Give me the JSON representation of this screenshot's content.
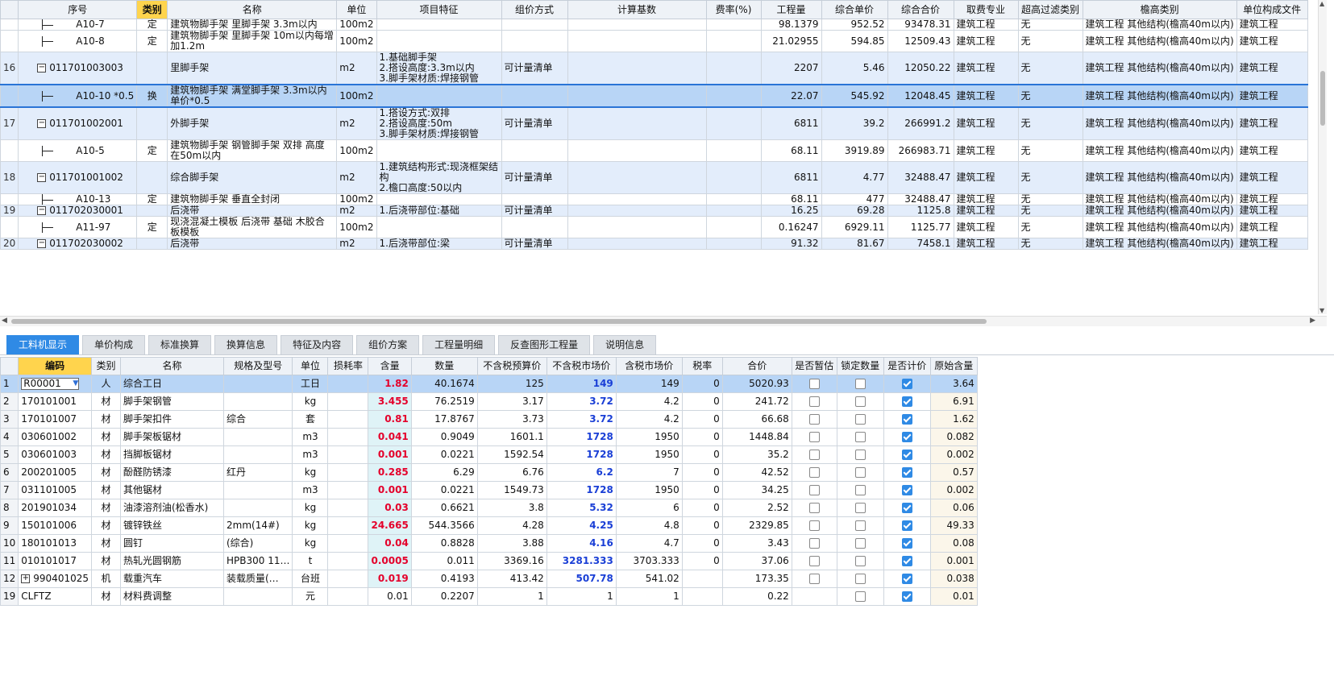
{
  "upper": {
    "headers": [
      "序号",
      "类别",
      "名称",
      "单位",
      "项目特征",
      "组价方式",
      "计算基数",
      "费率(%)",
      "工程量",
      "综合单价",
      "综合合价",
      "取费专业",
      "超高过滤类别",
      "檐高类别",
      "单位构成文件"
    ],
    "rows": [
      {
        "type": "sub",
        "seq": "",
        "code": "A10-7",
        "cat": "定",
        "name": "建筑物脚手架 里脚手架 3.3m以内",
        "unit": "100m2",
        "feature": "",
        "method": "",
        "base": "",
        "rate": "",
        "qty": "98.1379",
        "price": "952.52",
        "total": "93478.31",
        "spec": "建筑工程",
        "filter": "无",
        "height": "建筑工程 其他结构(檐高40m以内)",
        "file": "建筑工程"
      },
      {
        "type": "sub",
        "seq": "",
        "code": "A10-8",
        "cat": "定",
        "name": "建筑物脚手架 里脚手架 10m以内每增加1.2m",
        "unit": "100m2",
        "feature": "",
        "method": "",
        "base": "",
        "rate": "",
        "qty": "21.02955",
        "price": "594.85",
        "total": "12509.43",
        "spec": "建筑工程",
        "filter": "无",
        "height": "建筑工程 其他结构(檐高40m以内)",
        "file": "建筑工程"
      },
      {
        "type": "main",
        "seq": "16",
        "code": "011701003003",
        "cat": "",
        "name": "里脚手架",
        "unit": "m2",
        "feature": "1.基础脚手架\n2.搭设高度:3.3m以内\n3.脚手架材质:焊接钢管",
        "method": "可计量清单",
        "base": "",
        "rate": "",
        "qty": "2207",
        "price": "5.46",
        "total": "12050.22",
        "spec": "建筑工程",
        "filter": "无",
        "height": "建筑工程 其他结构(檐高40m以内)",
        "file": "建筑工程"
      },
      {
        "type": "sel",
        "seq": "",
        "code": "A10-10 *0.5",
        "cat": "换",
        "name": "建筑物脚手架 满堂脚手架 3.3m以内  单价*0.5",
        "unit": "100m2",
        "feature": "",
        "method": "",
        "base": "",
        "rate": "",
        "qty": "22.07",
        "price": "545.92",
        "total": "12048.45",
        "spec": "建筑工程",
        "filter": "无",
        "height": "建筑工程 其他结构(檐高40m以内)",
        "file": "建筑工程"
      },
      {
        "type": "main",
        "seq": "17",
        "code": "011701002001",
        "cat": "",
        "name": "外脚手架",
        "unit": "m2",
        "feature": "1.搭设方式:双排\n2.搭设高度:50m\n3.脚手架材质:焊接钢管",
        "method": "可计量清单",
        "base": "",
        "rate": "",
        "qty": "6811",
        "price": "39.2",
        "total": "266991.2",
        "spec": "建筑工程",
        "filter": "无",
        "height": "建筑工程 其他结构(檐高40m以内)",
        "file": "建筑工程"
      },
      {
        "type": "sub",
        "seq": "",
        "code": "A10-5",
        "cat": "定",
        "name": "建筑物脚手架 钢管脚手架 双排 高度在50m以内",
        "unit": "100m2",
        "feature": "",
        "method": "",
        "base": "",
        "rate": "",
        "qty": "68.11",
        "price": "3919.89",
        "total": "266983.71",
        "spec": "建筑工程",
        "filter": "无",
        "height": "建筑工程 其他结构(檐高40m以内)",
        "file": "建筑工程"
      },
      {
        "type": "main",
        "seq": "18",
        "code": "011701001002",
        "cat": "",
        "name": "综合脚手架",
        "unit": "m2",
        "feature": "1.建筑结构形式:现浇框架结构\n2.檐口高度:50以内",
        "method": "可计量清单",
        "base": "",
        "rate": "",
        "qty": "6811",
        "price": "4.77",
        "total": "32488.47",
        "spec": "建筑工程",
        "filter": "无",
        "height": "建筑工程 其他结构(檐高40m以内)",
        "file": "建筑工程"
      },
      {
        "type": "sub",
        "seq": "",
        "code": "A10-13",
        "cat": "定",
        "name": "建筑物脚手架 垂直全封闭",
        "unit": "100m2",
        "feature": "",
        "method": "",
        "base": "",
        "rate": "",
        "qty": "68.11",
        "price": "477",
        "total": "32488.47",
        "spec": "建筑工程",
        "filter": "无",
        "height": "建筑工程 其他结构(檐高40m以内)",
        "file": "建筑工程"
      },
      {
        "type": "main",
        "seq": "19",
        "code": "011702030001",
        "cat": "",
        "name": "后浇带",
        "unit": "m2",
        "feature": "1.后浇带部位:基础",
        "method": "可计量清单",
        "base": "",
        "rate": "",
        "qty": "16.25",
        "price": "69.28",
        "total": "1125.8",
        "spec": "建筑工程",
        "filter": "无",
        "height": "建筑工程 其他结构(檐高40m以内)",
        "file": "建筑工程"
      },
      {
        "type": "sub",
        "seq": "",
        "code": "A11-97",
        "cat": "定",
        "name": "现浇混凝土模板 后浇带 基础 木胶合板模板",
        "unit": "100m2",
        "feature": "",
        "method": "",
        "base": "",
        "rate": "",
        "qty": "0.16247",
        "price": "6929.11",
        "total": "1125.77",
        "spec": "建筑工程",
        "filter": "无",
        "height": "建筑工程 其他结构(檐高40m以内)",
        "file": "建筑工程"
      },
      {
        "type": "main",
        "seq": "20",
        "code": "011702030002",
        "cat": "",
        "name": "后浇带",
        "unit": "m2",
        "feature": "1.后浇带部位:梁",
        "method": "可计量清单",
        "base": "",
        "rate": "",
        "qty": "91.32",
        "price": "81.67",
        "total": "7458.1",
        "spec": "建筑工程",
        "filter": "无",
        "height": "建筑工程 其他结构(檐高40m以内)",
        "file": "建筑工程"
      }
    ]
  },
  "tabs": [
    "工料机显示",
    "单价构成",
    "标准换算",
    "换算信息",
    "特征及内容",
    "组价方案",
    "工程量明细",
    "反查图形工程量",
    "说明信息"
  ],
  "lower": {
    "headers": [
      "",
      "编码",
      "类别",
      "名称",
      "规格及型号",
      "单位",
      "损耗率",
      "含量",
      "数量",
      "不含税预算价",
      "不含税市场价",
      "含税市场价",
      "税率",
      "合价",
      "是否暂估",
      "锁定数量",
      "是否计价",
      "原始含量"
    ],
    "rows": [
      {
        "rn": "1",
        "code": "R00001",
        "cat": "人",
        "name": "综合工日",
        "spec": "",
        "unit": "工日",
        "loss": "",
        "content": "1.82",
        "amount": "40.1674",
        "budget": "125",
        "market": "149",
        "taxmarket": "149",
        "tax": "0",
        "total": "5020.93",
        "est": false,
        "lock": false,
        "priced": true,
        "orig": "3.64"
      },
      {
        "rn": "2",
        "code": "170101001",
        "cat": "材",
        "name": "脚手架钢管",
        "spec": "",
        "unit": "kg",
        "loss": "",
        "content": "3.455",
        "amount": "76.2519",
        "budget": "3.17",
        "market": "3.72",
        "taxmarket": "4.2",
        "tax": "0",
        "total": "241.72",
        "est": false,
        "lock": false,
        "priced": true,
        "orig": "6.91"
      },
      {
        "rn": "3",
        "code": "170101007",
        "cat": "材",
        "name": "脚手架扣件",
        "spec": "综合",
        "unit": "套",
        "loss": "",
        "content": "0.81",
        "amount": "17.8767",
        "budget": "3.73",
        "market": "3.72",
        "taxmarket": "4.2",
        "tax": "0",
        "total": "66.68",
        "est": false,
        "lock": false,
        "priced": true,
        "orig": "1.62"
      },
      {
        "rn": "4",
        "code": "030601002",
        "cat": "材",
        "name": "脚手架板锯材",
        "spec": "",
        "unit": "m3",
        "loss": "",
        "content": "0.041",
        "amount": "0.9049",
        "budget": "1601.1",
        "market": "1728",
        "taxmarket": "1950",
        "tax": "0",
        "total": "1448.84",
        "est": false,
        "lock": false,
        "priced": true,
        "orig": "0.082"
      },
      {
        "rn": "5",
        "code": "030601003",
        "cat": "材",
        "name": "挡脚板锯材",
        "spec": "",
        "unit": "m3",
        "loss": "",
        "content": "0.001",
        "amount": "0.0221",
        "budget": "1592.54",
        "market": "1728",
        "taxmarket": "1950",
        "tax": "0",
        "total": "35.2",
        "est": false,
        "lock": false,
        "priced": true,
        "orig": "0.002"
      },
      {
        "rn": "6",
        "code": "200201005",
        "cat": "材",
        "name": "酚醛防锈漆",
        "spec": "红丹",
        "unit": "kg",
        "loss": "",
        "content": "0.285",
        "amount": "6.29",
        "budget": "6.76",
        "market": "6.2",
        "taxmarket": "7",
        "tax": "0",
        "total": "42.52",
        "est": false,
        "lock": false,
        "priced": true,
        "orig": "0.57"
      },
      {
        "rn": "7",
        "code": "031101005",
        "cat": "材",
        "name": "其他锯材",
        "spec": "",
        "unit": "m3",
        "loss": "",
        "content": "0.001",
        "amount": "0.0221",
        "budget": "1549.73",
        "market": "1728",
        "taxmarket": "1950",
        "tax": "0",
        "total": "34.25",
        "est": false,
        "lock": false,
        "priced": true,
        "orig": "0.002"
      },
      {
        "rn": "8",
        "code": "201901034",
        "cat": "材",
        "name": "油漆溶剂油(松香水)",
        "spec": "",
        "unit": "kg",
        "loss": "",
        "content": "0.03",
        "amount": "0.6621",
        "budget": "3.8",
        "market": "5.32",
        "taxmarket": "6",
        "tax": "0",
        "total": "2.52",
        "est": false,
        "lock": false,
        "priced": true,
        "orig": "0.06"
      },
      {
        "rn": "9",
        "code": "150101006",
        "cat": "材",
        "name": "镀锌铁丝",
        "spec": "2mm(14#)",
        "unit": "kg",
        "loss": "",
        "content": "24.665",
        "amount": "544.3566",
        "budget": "4.28",
        "market": "4.25",
        "taxmarket": "4.8",
        "tax": "0",
        "total": "2329.85",
        "est": false,
        "lock": false,
        "priced": true,
        "orig": "49.33"
      },
      {
        "rn": "10",
        "code": "180101013",
        "cat": "材",
        "name": "圆钉",
        "spec": "(综合)",
        "unit": "kg",
        "loss": "",
        "content": "0.04",
        "amount": "0.8828",
        "budget": "3.88",
        "market": "4.16",
        "taxmarket": "4.7",
        "tax": "0",
        "total": "3.43",
        "est": false,
        "lock": false,
        "priced": true,
        "orig": "0.08"
      },
      {
        "rn": "11",
        "code": "010101017",
        "cat": "材",
        "name": "热轧光圆钢筋",
        "spec": "HPB300 11…",
        "unit": "t",
        "loss": "",
        "content": "0.0005",
        "amount": "0.011",
        "budget": "3369.16",
        "market": "3281.333",
        "taxmarket": "3703.333",
        "tax": "0",
        "total": "37.06",
        "est": false,
        "lock": false,
        "priced": true,
        "orig": "0.001"
      },
      {
        "rn": "12",
        "code": "990401025",
        "cat": "机",
        "name": "载重汽车",
        "spec": "装载质量(…",
        "unit": "台班",
        "loss": "",
        "content": "0.019",
        "amount": "0.4193",
        "budget": "413.42",
        "market": "507.78",
        "taxmarket": "541.02",
        "tax": "",
        "total": "173.35",
        "est": false,
        "lock": false,
        "priced": true,
        "orig": "0.038",
        "expand": true
      },
      {
        "rn": "19",
        "code": "CLFTZ",
        "cat": "材",
        "name": "材料费调整",
        "spec": "",
        "unit": "元",
        "loss": "",
        "content": "0.01",
        "amount": "0.2207",
        "budget": "1",
        "market": "1",
        "taxmarket": "1",
        "tax": "",
        "total": "0.22",
        "est": null,
        "lock": false,
        "priced": true,
        "orig": "0.01",
        "plain": true
      }
    ]
  }
}
